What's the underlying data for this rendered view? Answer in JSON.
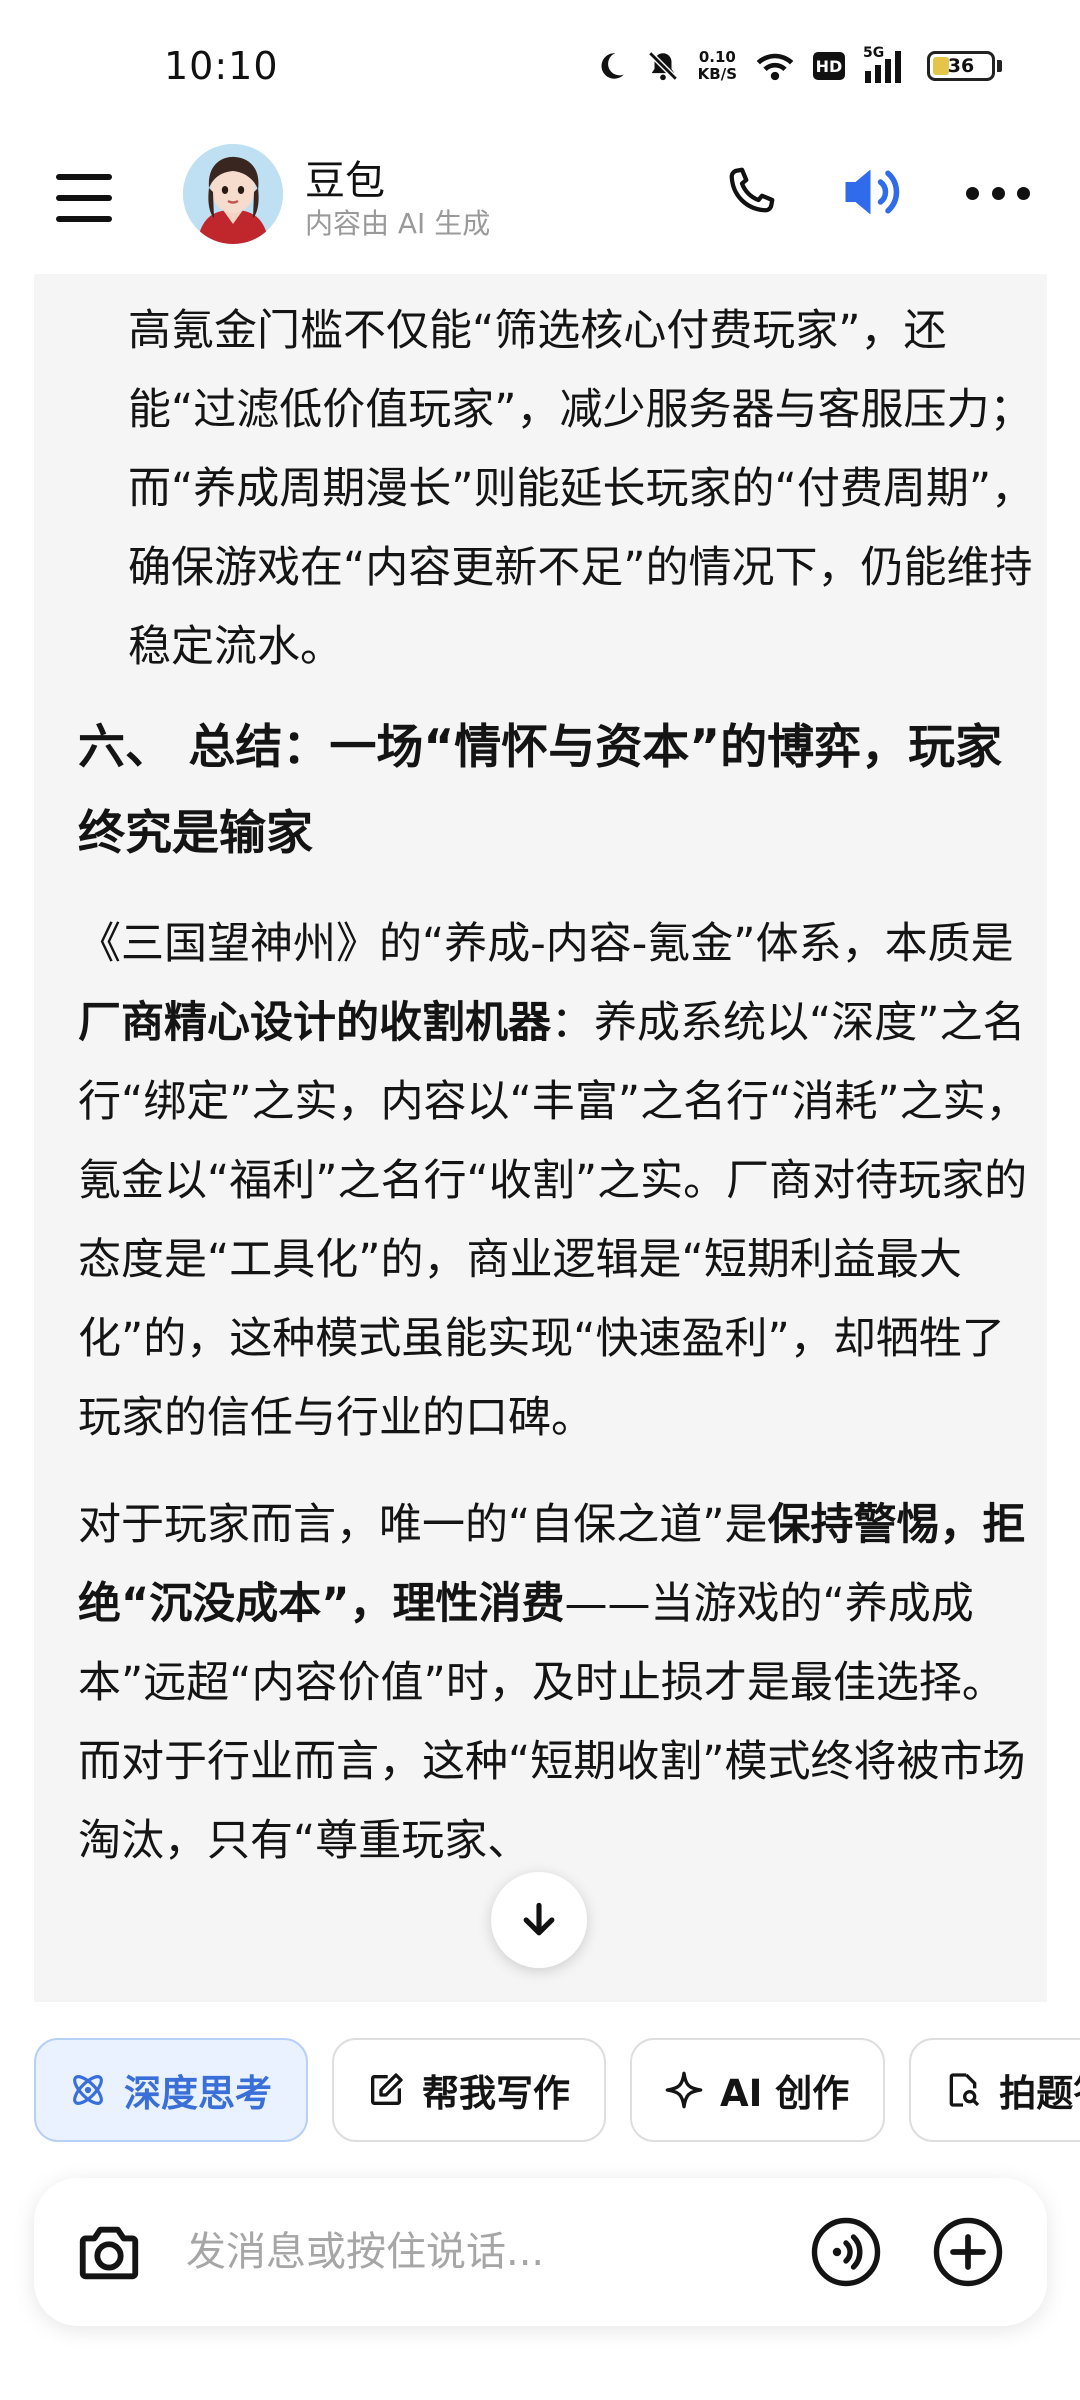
{
  "status_bar": {
    "time": "10:10",
    "net_speed_value": "0.10",
    "net_speed_unit": "KB/S",
    "hd_label": "HD",
    "signal_label": "5G",
    "battery_level": "36",
    "battery_color": "#e5c44b"
  },
  "header": {
    "bot_name": "豆包",
    "bot_subtitle": "内容由 AI 生成"
  },
  "message": {
    "para_continued": "高氪金门槛不仅能“筛选核心付费玩家”，还能“过滤低价值玩家”，减少服务器与客服压力；而“养成周期漫长”则能延长玩家的“付费周期”，确保游戏在“内容更新不足”的情况下，仍能维持稳定流水。",
    "section_heading": "六、 总结：一场“情怀与资本”的博弈，玩家终究是输家",
    "para1": {
      "pre": "《三国望神州》的“养成-内容-氪金”体系，本质是",
      "bold": "厂商精心设计的收割机器",
      "post": "：养成系统以“深度”之名行“绑定”之实，内容以“丰富”之名行“消耗”之实，氪金以“福利”之名行“收割”之实。厂商对待玩家的态度是“工具化”的，商业逻辑是“短期利益最大化”的，这种模式虽能实现“快速盈利”，却牺牲了玩家的信任与行业的口碑。"
    },
    "para2": {
      "pre": "对于玩家而言，唯一的“自保之道”是",
      "bold": "保持警惕，拒绝“沉没成本”，理性消费",
      "post": "——当游戏的“养成成本”远超“内容价值”时，及时止损才是最佳选择。而对于行业而言，这种“短期收割”模式终将被市场淘汰，只有“尊重玩家、"
    }
  },
  "chips": [
    {
      "label": "深度思考",
      "icon": "atom-icon",
      "active": true
    },
    {
      "label": "帮我写作",
      "icon": "edit-icon",
      "active": false
    },
    {
      "label": "AI 创作",
      "icon": "sparkle-icon",
      "active": false
    },
    {
      "label": "拍题答疑",
      "icon": "scan-doc-icon",
      "active": false
    }
  ],
  "input": {
    "placeholder": "发消息或按住说话..."
  },
  "colors": {
    "accent": "#3a6fd8",
    "card_bg": "#f5f5f5",
    "speaker_blue": "#2f6bea"
  }
}
